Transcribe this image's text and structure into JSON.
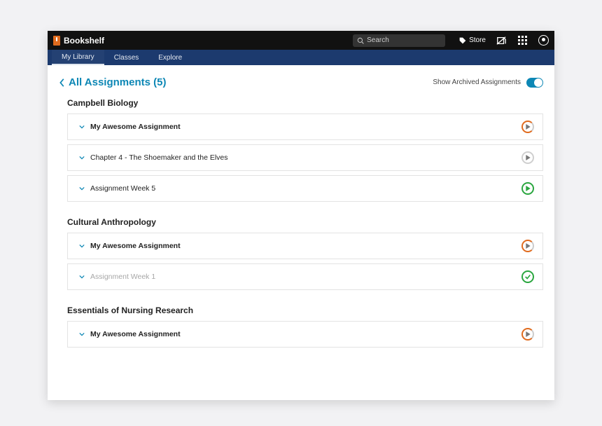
{
  "brand": "Bookshelf",
  "search_placeholder": "Search",
  "store_label": "Store",
  "tabs": {
    "library": "My Library",
    "classes": "Classes",
    "explore": "Explore"
  },
  "page_title": "All Assignments (5)",
  "archived_label": "Show Archived Assignments",
  "sections": [
    {
      "title": "Campbell Biology",
      "rows": [
        {
          "title": "My Awesome Assignment",
          "status": "orange-play"
        },
        {
          "title": "Chapter 4 - The Shoemaker and the Elves",
          "status": "grey-play",
          "weight": "normal"
        },
        {
          "title": "Assignment Week 5",
          "status": "green-play",
          "weight": "normal"
        }
      ]
    },
    {
      "title": "Cultural Anthropology",
      "rows": [
        {
          "title": "My Awesome Assignment",
          "status": "orange-play"
        },
        {
          "title": "Assignment Week 1",
          "status": "green-check",
          "muted": true
        }
      ]
    },
    {
      "title": "Essentials of Nursing Research",
      "rows": [
        {
          "title": "My Awesome Assignment",
          "status": "orange-play"
        }
      ]
    }
  ]
}
